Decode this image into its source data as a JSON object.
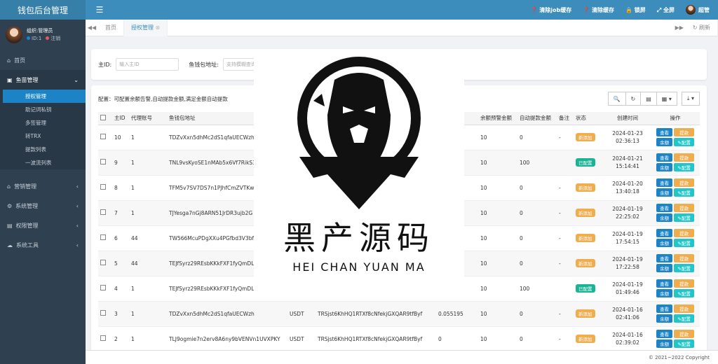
{
  "sidebar": {
    "brand": "钱包后台管理",
    "user": {
      "name": "组织:管理员",
      "id": "ID:1",
      "logout": "注销"
    },
    "items": [
      {
        "label": "首页",
        "icon": "home-icon"
      },
      {
        "label": "鱼苗管理",
        "icon": "fish-icon"
      },
      {
        "label": "营销管理",
        "icon": "bank-icon"
      },
      {
        "label": "系统管理",
        "icon": "gear-icon"
      },
      {
        "label": "权限管理",
        "icon": "list-icon"
      },
      {
        "label": "系统工具",
        "icon": "cloud-icon"
      }
    ],
    "sub_items": [
      "授权管理",
      "助记词私钥",
      "多签管理",
      "转TRX",
      "提款列表",
      "一波流列表"
    ]
  },
  "topbar": {
    "menu_icon": "☰",
    "clear_job": "清除job缓存",
    "clear_cache": "清除缓存",
    "lock": "锁屏",
    "fullscreen": "全屏",
    "username": "超管"
  },
  "tabs": {
    "home": "首页",
    "active": "授权管理",
    "refresh": "刷新"
  },
  "search": {
    "main_id_label": "主ID:",
    "main_id_placeholder": "输入主ID",
    "wallet_label": "鱼钱包地址:",
    "wallet_placeholder": "支持模糊查询"
  },
  "table": {
    "tip": "配置：可配置余额告警,自动提款金额,满足金额自动提款",
    "headers": [
      "主ID",
      "代理账号",
      "鱼钱包地址",
      "",
      "",
      "额",
      "余额预警金额",
      "自动提款金额",
      "备注",
      "状态",
      "创建时间",
      "操作"
    ],
    "ops": {
      "view": "查看",
      "withdraw": "提款",
      "balance": "余额",
      "config": "配置"
    },
    "rows": [
      {
        "id": "10",
        "agent": "1",
        "wallet": "TDZvXxn5dhMc2dS1qfaUECWzh",
        "type": "",
        "auth": "",
        "bal": "",
        "alert": "10",
        "auto": "0",
        "note": "-",
        "status": "新添加",
        "status_kind": "new",
        "date": "2024-01-23",
        "time": "02:36:13"
      },
      {
        "id": "9",
        "agent": "1",
        "wallet": "TNL9vsKyoSE1nMAb5x6Vf7RikS3",
        "type": "",
        "auth": "",
        "bal": "",
        "alert": "10",
        "auto": "100",
        "note": "",
        "status": "已配置",
        "status_kind": "done",
        "date": "2024-01-21",
        "time": "15:14:41"
      },
      {
        "id": "8",
        "agent": "1",
        "wallet": "TFM5v7SV7DS7n1PJhfCmZVTKw",
        "type": "",
        "auth": "",
        "bal": "",
        "alert": "10",
        "auto": "0",
        "note": "-",
        "status": "新添加",
        "status_kind": "new",
        "date": "2024-01-20",
        "time": "13:40:18"
      },
      {
        "id": "7",
        "agent": "1",
        "wallet": "TJYesga7nGj8ARN51JrDR3ujb2G",
        "type": "",
        "auth": "",
        "bal": "",
        "alert": "10",
        "auto": "0",
        "note": "-",
        "status": "新添加",
        "status_kind": "new",
        "date": "2024-01-19",
        "time": "22:25:02"
      },
      {
        "id": "6",
        "agent": "44",
        "wallet": "TW566McuPDgXXu4PGfbd3V3bf",
        "type": "",
        "auth": "",
        "bal": "",
        "alert": "10",
        "auto": "0",
        "note": "-",
        "status": "新添加",
        "status_kind": "new",
        "date": "2024-01-19",
        "time": "17:54:15"
      },
      {
        "id": "5",
        "agent": "44",
        "wallet": "TEJfSyrz29REsbKKkFXF1fyQmDL",
        "type": "",
        "auth": "",
        "bal": "",
        "alert": "10",
        "auto": "0",
        "note": "-",
        "status": "新添加",
        "status_kind": "new",
        "date": "2024-01-19",
        "time": "17:22:58"
      },
      {
        "id": "4",
        "agent": "1",
        "wallet": "TEJfSyrz29REsbKKkFXF1fyQmDL",
        "type": "",
        "auth": "",
        "bal": "",
        "alert": "10",
        "auto": "100",
        "note": "",
        "status": "已配置",
        "status_kind": "done",
        "date": "2024-01-19",
        "time": "01:49:46"
      },
      {
        "id": "3",
        "agent": "1",
        "wallet": "TDZvXxn5dhMc2dS1qfaUECWzh",
        "type": "USDT",
        "auth": "TRSjst6KhHQ1RTXf8cNfekjGXQAR9tfByf",
        "bal": "0.055195",
        "alert": "10",
        "auto": "0",
        "note": "-",
        "status": "新添加",
        "status_kind": "new",
        "date": "2024-01-16",
        "time": "02:41:06"
      },
      {
        "id": "2",
        "agent": "1",
        "wallet": "TLJ9ogmie7n2erv8A6ny9bVENVn1UVXPKY",
        "type": "USDT",
        "auth": "TRSjst6KhHQ1RTXf8cNfekjGXQAR9tfByf",
        "bal": "0",
        "alert": "10",
        "auto": "0",
        "note": "-",
        "status": "新添加",
        "status_kind": "new",
        "date": "2024-01-16",
        "time": "02:39:02"
      }
    ]
  },
  "footer": "© 2021~2022 Copyright",
  "watermark": {
    "cn": "黑产源码",
    "en": "HEI CHAN YUAN MA"
  },
  "colors": {
    "sidebar": "#2f4050",
    "topbar": "#3c8dbc",
    "active": "#1c84c6",
    "new": "#f0ad4e",
    "done": "#1ab394",
    "view": "#1c84c6",
    "balance": "#23c6c8"
  }
}
